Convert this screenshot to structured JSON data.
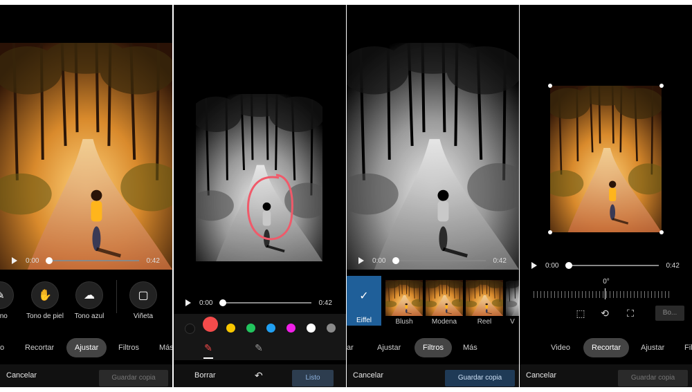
{
  "player": {
    "start": "0:00",
    "end": "0:42"
  },
  "panel1": {
    "tools": [
      {
        "label": "Tono",
        "icon": "dropper-icon"
      },
      {
        "label": "Tono de piel",
        "icon": "hand-icon"
      },
      {
        "label": "Tono azul",
        "icon": "cloud-icon"
      },
      {
        "label": "Viñeta",
        "icon": "vignette-icon"
      }
    ],
    "tabs": [
      "o",
      "Recortar",
      "Ajustar",
      "Filtros",
      "Más"
    ],
    "active_tab": "Ajustar",
    "cancel": "Cancelar",
    "save": "Guardar copia"
  },
  "panel2": {
    "colors": [
      "#111111",
      "#f44b4b",
      "#f8c700",
      "#22c45e",
      "#21a0f2",
      "#f020e8",
      "#ffffff",
      "#8a8a8a"
    ],
    "erase": "Borrar",
    "done": "Listo"
  },
  "panel3": {
    "filters": [
      "Eiffel",
      "Blush",
      "Modena",
      "Reel",
      "V"
    ],
    "tabs": [
      "ar",
      "Ajustar",
      "Filtros",
      "Más"
    ],
    "active_tab": "Filtros",
    "cancel": "Cancelar",
    "save": "Guardar copia"
  },
  "panel4": {
    "angle": "0°",
    "small_button": "Bo...",
    "tabs": [
      "Video",
      "Recortar",
      "Ajustar",
      "Fil"
    ],
    "active_tab": "Recortar",
    "cancel": "Cancelar",
    "save": "Guardar copia"
  },
  "colors": {
    "accent_blue": "#1f5f99",
    "highlight_circle": "#f05a6a"
  }
}
